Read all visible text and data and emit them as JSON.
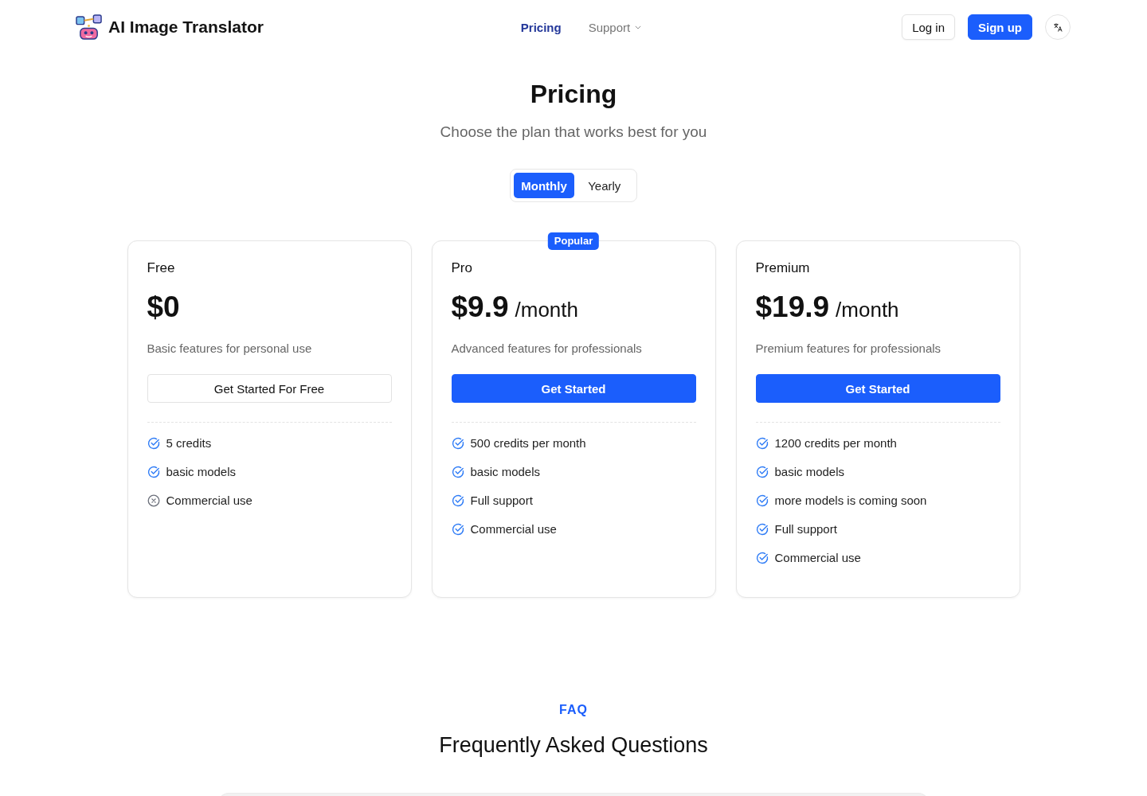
{
  "header": {
    "logo": {
      "text": "AI Image Translator"
    },
    "nav": [
      {
        "label": "Pricing",
        "selected": true,
        "kind": "link"
      },
      {
        "label": "Support",
        "selected": false,
        "kind": "dropdown"
      }
    ],
    "buttons": [
      {
        "label": "Log in",
        "kind": "outline"
      },
      {
        "label": "Sign up",
        "kind": "primary"
      }
    ]
  },
  "pricing": {
    "title": "Pricing",
    "subtitle": "Choose the plan that works best for you",
    "billing_toggle": [
      {
        "label": "Monthly",
        "selected": true
      },
      {
        "label": "Yearly",
        "selected": false
      }
    ],
    "plans": [
      {
        "name": "Free",
        "price": "$0",
        "description": "Basic features for personal use",
        "button": {
          "label": "Get Started For Free",
          "kind": "outline"
        },
        "features": [
          {
            "text": "5 credits",
            "included": true
          },
          {
            "text": "basic models",
            "included": true
          },
          {
            "text": "Commercial use",
            "included": false
          }
        ]
      },
      {
        "name": "Pro",
        "badge": "Popular",
        "price": "$9.9",
        "period": "/month",
        "description": "Advanced features for professionals",
        "button": {
          "label": "Get Started",
          "kind": "primary"
        },
        "features": [
          {
            "text": "500 credits per month",
            "included": true
          },
          {
            "text": "basic models",
            "included": true
          },
          {
            "text": "Full support",
            "included": true
          },
          {
            "text": "Commercial use",
            "included": true
          }
        ]
      },
      {
        "name": "Premium",
        "price": "$19.9",
        "period": "/month",
        "description": "Premium features for professionals",
        "button": {
          "label": "Get Started",
          "kind": "primary"
        },
        "features": [
          {
            "text": "1200 credits per month",
            "included": true
          },
          {
            "text": "basic models",
            "included": true
          },
          {
            "text": "more models is coming soon",
            "included": true
          },
          {
            "text": "Full support",
            "included": true
          },
          {
            "text": "Commercial use",
            "included": true
          }
        ]
      }
    ]
  },
  "faq": {
    "eyebrow": "FAQ",
    "title": "Frequently Asked Questions"
  }
}
